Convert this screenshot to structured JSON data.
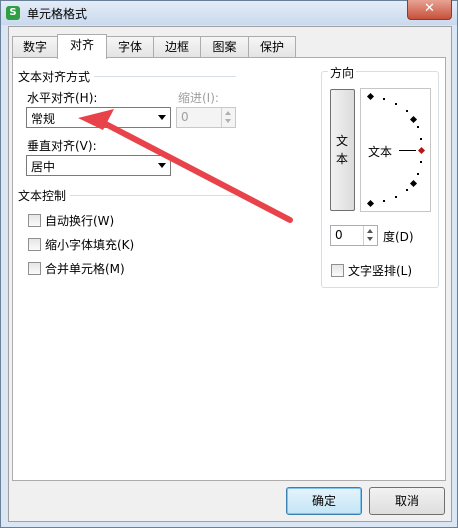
{
  "window": {
    "title": "单元格格式",
    "app_icon_glyph": "S",
    "close_glyph": "✕"
  },
  "tabs": [
    {
      "label": "数字"
    },
    {
      "label": "对齐"
    },
    {
      "label": "字体"
    },
    {
      "label": "边框"
    },
    {
      "label": "图案"
    },
    {
      "label": "保护"
    }
  ],
  "active_tab": "对齐",
  "alignment": {
    "group_title": "文本对齐方式",
    "horizontal_label": "水平对齐(H):",
    "horizontal_value": "常规",
    "indent_label": "缩进(I):",
    "indent_value": "0",
    "vertical_label": "垂直对齐(V):",
    "vertical_value": "居中"
  },
  "text_control": {
    "group_title": "文本控制",
    "options": [
      {
        "label": "自动换行(W)",
        "checked": false
      },
      {
        "label": "缩小字体填充(K)",
        "checked": false
      },
      {
        "label": "合并单元格(M)",
        "checked": false
      }
    ]
  },
  "orientation": {
    "group_title": "方向",
    "vertical_text": [
      "文",
      "本"
    ],
    "dial_text": "文本",
    "degree_value": "0",
    "degree_label": "度(D)",
    "vertical_arrange_label": "文字竖排(L)",
    "vertical_arrange_checked": false
  },
  "buttons": {
    "ok": "确定",
    "cancel": "取消"
  },
  "colors": {
    "annotation_arrow": "#e8434a",
    "dial_marker": "#b01818"
  }
}
